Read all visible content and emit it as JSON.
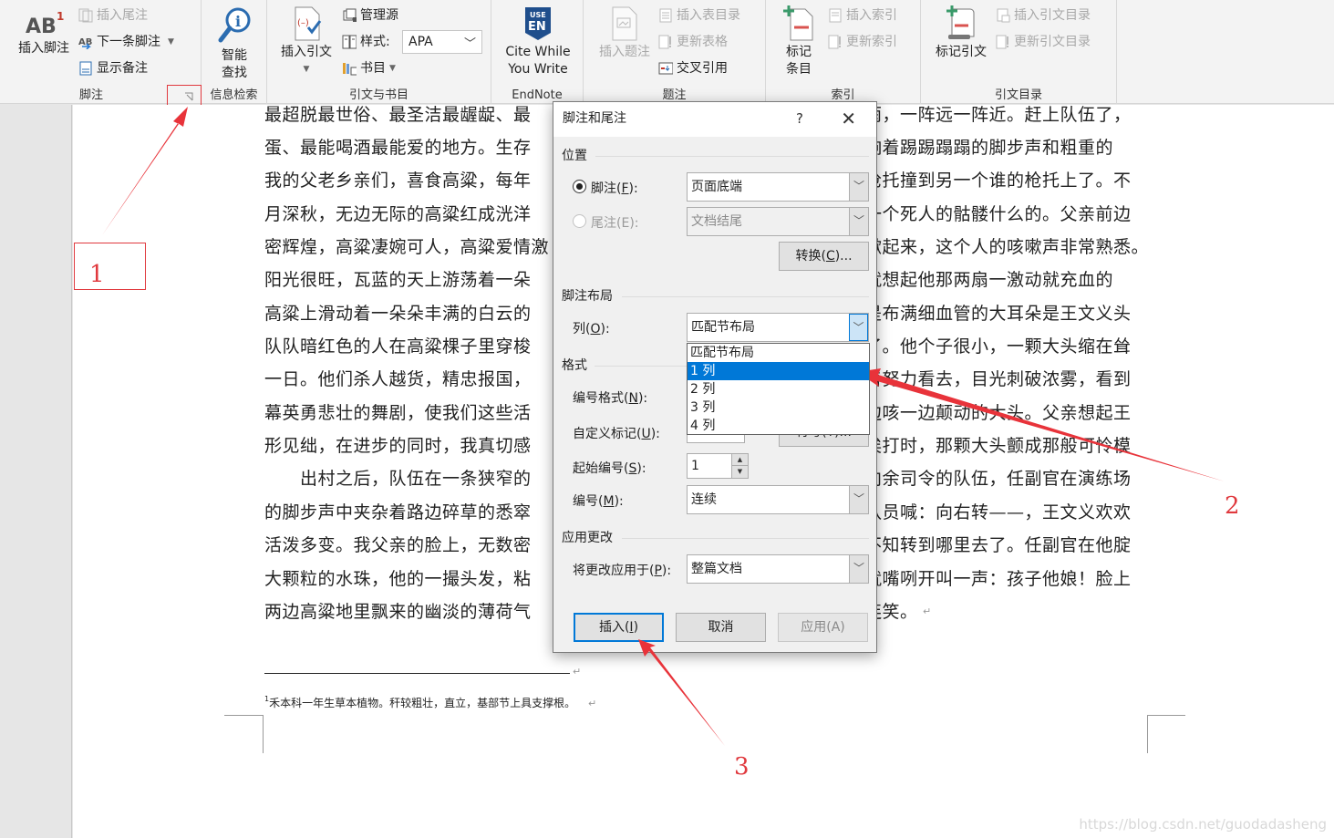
{
  "ribbon": {
    "groups": {
      "footnotes": {
        "label": "脚注",
        "insert_footnote": "插入脚注",
        "insert_endnote": "插入尾注",
        "next_footnote": "下一条脚注",
        "show_notes": "显示备注"
      },
      "research": {
        "label": "信息检索",
        "smart_lookup_line1": "智能",
        "smart_lookup_line2": "查找"
      },
      "citations": {
        "label": "引文与书目",
        "insert_citation": "插入引文",
        "manage_sources": "管理源",
        "style_label": "样式:",
        "style_value": "APA",
        "bibliography": "书目"
      },
      "endnote": {
        "label": "EndNote",
        "logo_line1": "USE",
        "logo_line2": "EN",
        "cite_line1": "Cite While",
        "cite_line2": "You Write"
      },
      "captions": {
        "label": "题注",
        "insert_caption": "插入题注",
        "insert_table_of_figures": "插入表目录",
        "update_table": "更新表格",
        "cross_reference": "交叉引用"
      },
      "index": {
        "label": "索引",
        "mark_entry_line1": "标记",
        "mark_entry_line2": "条目",
        "insert_index": "插入索引",
        "update_index": "更新索引"
      },
      "table_of_authorities": {
        "label": "引文目录",
        "mark_citation": "标记引文",
        "insert_toa": "插入引文目录",
        "update_toa": "更新引文目录"
      }
    }
  },
  "document": {
    "left_lines": [
      "最超脱最世俗、最圣洁最龌龊、最",
      "蛋、最能喝酒最能爱的地方。生存",
      "我的父老乡亲们，喜食高粱，每年",
      "月深秋，无边无际的高粱红成洸洋",
      "密辉煌，高粱凄婉可人，高粱爱情激",
      "阳光很旺，瓦蓝的天上游荡着一朵",
      "高粱上滑动着一朵朵丰满的白云的",
      "队队暗红色的人在高粱棵子里穿梭",
      "一日。他们杀人越货，精忠报国，",
      "幕英勇悲壮的舞剧，使我们这些活",
      "形见绌，在进步的同时，我真切感",
      "　　出村之后，队伍在一条狭窄的",
      "的脚步声中夹杂着路边碎草的悉窣",
      "活泼多变。我父亲的脸上，无数密",
      "大颗粒的水珠，他的一撮头发，粘",
      "两边高粱地里飘来的幽淡的薄荷气"
    ],
    "right_lines": [
      "雨，一阵远一阵近。赶上队伍了，",
      "响着踢踢蹋蹋的脚步声和粗重的",
      "枪托撞到另一个谁的枪托上了。不",
      "一个死人的骷髅什么的。父亲前边",
      "嗽起来，这个人的咳嗽声非常熟悉。",
      "就想起他那两扇一激动就充血的",
      "是布满细血管的大耳朵是王文义头",
      "了。他个子很小，一颗大头缩在耸",
      "着努力看去，目光刺破浓雾，看到",
      "边咳一边颠动的大头。父亲想起王",
      "挨打时，那颗大头颤成那般可怜模",
      "向余司令的队伍，任副官在演练场",
      "队员喊：向右转——，王文义欢欢",
      "不知转到哪里去了。任副官在他腚",
      "就嘴咧开叫一声：孩子他娘！脸上",
      "连笑。"
    ],
    "paragraph_mark": "↵",
    "footnote": {
      "number": "1",
      "text": "禾本科一年生草本植物。秆较粗壮，直立，基部节上具支撑根。"
    },
    "watermark": "https://blog.csdn.net/guodadasheng"
  },
  "dialog": {
    "title": "脚注和尾注",
    "help": "?",
    "close": "✕",
    "position_section": "位置",
    "footnote_radio": {
      "label_pre": "脚注(",
      "mnemonic": "F",
      "label_post": "):",
      "checked": true
    },
    "footnote_location": "页面底端",
    "endnote_radio": {
      "label_pre": "尾注(",
      "mnemonic": "E",
      "label_post": "):",
      "checked": false
    },
    "endnote_location": "文档结尾",
    "convert_button": {
      "pre": "转换(",
      "mnemonic": "C",
      "post": ")..."
    },
    "layout_section": "脚注布局",
    "columns_label": {
      "pre": "列(",
      "mnemonic": "O",
      "post": "):"
    },
    "columns_value": "匹配节布局",
    "columns_options": [
      "匹配节布局",
      "1 列",
      "2 列",
      "3 列",
      "4 列"
    ],
    "columns_highlighted": "1 列",
    "format_section": "格式",
    "number_format_label": {
      "pre": "编号格式(",
      "mnemonic": "N",
      "post": "):"
    },
    "custom_mark_label": {
      "pre": "自定义标记(",
      "mnemonic": "U",
      "post": "):"
    },
    "symbol_button": "符号(Y)...",
    "start_at_label": {
      "pre": "起始编号(",
      "mnemonic": "S",
      "post": "):"
    },
    "start_at_value": "1",
    "numbering_label": {
      "pre": "编号(",
      "mnemonic": "M",
      "post": "):"
    },
    "numbering_value": "连续",
    "apply_section": "应用更改",
    "apply_to_label": {
      "pre": "将更改应用于(",
      "mnemonic": "P",
      "post": "):"
    },
    "apply_to_value": "整篇文档",
    "insert_button": {
      "pre": "插入(",
      "mnemonic": "I",
      "post": ")"
    },
    "cancel_button": "取消",
    "apply_button": "应用(A)"
  },
  "annotations": {
    "marker_1": "1",
    "marker_2": "2",
    "marker_3": "3",
    "color": "#e0393e"
  }
}
